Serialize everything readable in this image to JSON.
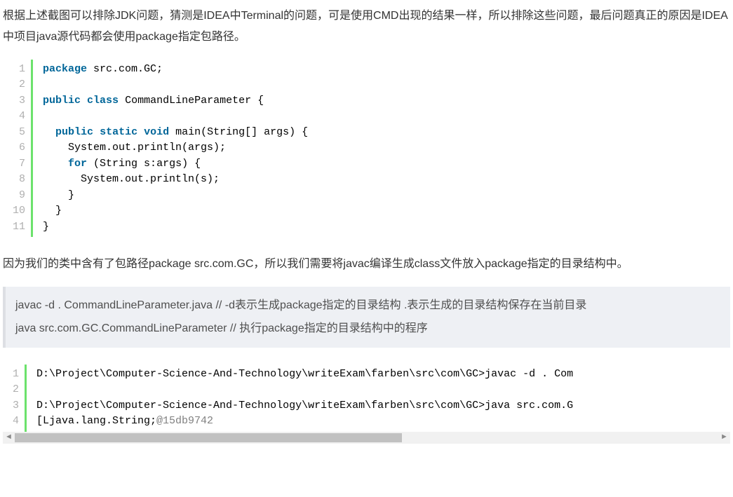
{
  "para1": "根据上述截图可以排除JDK问题，猜测是IDEA中Terminal的问题，可是使用CMD出现的结果一样，所以排除这些问题，最后问题真正的原因是IDEA中项目java源代码都会使用package指定包路径。",
  "code1": {
    "lineNumbers": [
      "1",
      "2",
      "3",
      "4",
      "5",
      "6",
      "7",
      "8",
      "9",
      "10",
      "11"
    ],
    "lines": [
      {
        "segments": [
          {
            "cls": "kw",
            "t": "package"
          },
          {
            "cls": "plain",
            "t": " src.com.GC;"
          }
        ]
      },
      {
        "segments": []
      },
      {
        "segments": [
          {
            "cls": "kw",
            "t": "public"
          },
          {
            "cls": "plain",
            "t": " "
          },
          {
            "cls": "kw",
            "t": "class"
          },
          {
            "cls": "plain",
            "t": " CommandLineParameter {"
          }
        ]
      },
      {
        "segments": []
      },
      {
        "segments": [
          {
            "cls": "plain",
            "t": "  "
          },
          {
            "cls": "kw",
            "t": "public"
          },
          {
            "cls": "plain",
            "t": " "
          },
          {
            "cls": "kw",
            "t": "static"
          },
          {
            "cls": "plain",
            "t": " "
          },
          {
            "cls": "kw",
            "t": "void"
          },
          {
            "cls": "plain",
            "t": " main(String[] args) {"
          }
        ]
      },
      {
        "segments": [
          {
            "cls": "plain",
            "t": "    System.out.println(args);"
          }
        ]
      },
      {
        "segments": [
          {
            "cls": "plain",
            "t": "    "
          },
          {
            "cls": "kw",
            "t": "for"
          },
          {
            "cls": "plain",
            "t": " (String s:args) {"
          }
        ]
      },
      {
        "segments": [
          {
            "cls": "plain",
            "t": "      System.out.println(s);"
          }
        ]
      },
      {
        "segments": [
          {
            "cls": "plain",
            "t": "    }"
          }
        ]
      },
      {
        "segments": [
          {
            "cls": "plain",
            "t": "  }"
          }
        ]
      },
      {
        "segments": [
          {
            "cls": "plain",
            "t": "}"
          }
        ]
      }
    ]
  },
  "para2": "因为我们的类中含有了包路径package src.com.GC，所以我们需要将javac编译生成class文件放入package指定的目录结构中。",
  "blockquote": {
    "line1": "javac -d . CommandLineParameter.java // -d表示生成package指定的目录结构 .表示生成的目录结构保存在当前目录",
    "line2": "java src.com.GC.CommandLineParameter // 执行package指定的目录结构中的程序"
  },
  "code2": {
    "lineNumbers": [
      "1",
      "2",
      "3",
      "4"
    ],
    "lines": [
      {
        "segments": [
          {
            "cls": "plain",
            "t": "D:\\Project\\Computer-Science-And-Technology\\writeExam\\farben\\src\\com\\GC>javac -d . Com"
          }
        ]
      },
      {
        "segments": []
      },
      {
        "segments": [
          {
            "cls": "plain",
            "t": "D:\\Project\\Computer-Science-And-Technology\\writeExam\\farben\\src\\com\\GC>java src.com.G"
          }
        ]
      },
      {
        "segments": [
          {
            "cls": "plain",
            "t": "[Ljava.lang.String;"
          },
          {
            "cls": "hash",
            "t": "@15db9742"
          }
        ]
      }
    ]
  },
  "scrollbar": {
    "left": "◄",
    "right": "►"
  }
}
